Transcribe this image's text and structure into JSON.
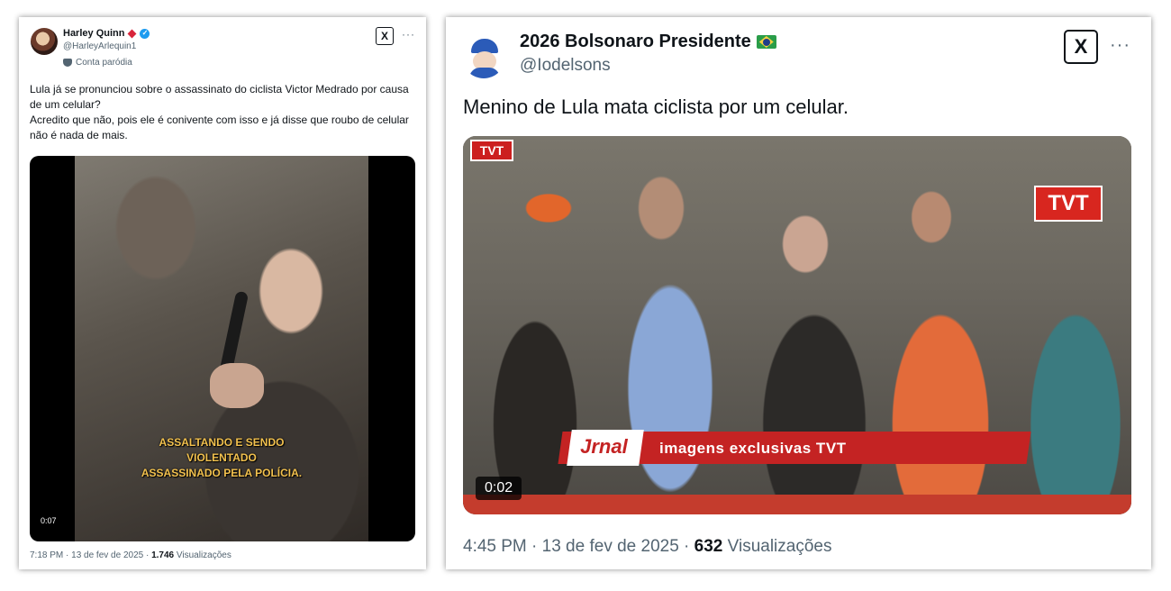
{
  "tweet1": {
    "name": "Harley Quinn",
    "handle": "@HarleyArlequin1",
    "parody": "Conta paródia",
    "text": [
      "Lula já se pronunciou sobre o assassinato do ciclista Victor Medrado por causa de um celular?",
      "Acredito que não,  pois ele é conivente com isso e já disse que roubo de celular não é nada de mais."
    ],
    "video": {
      "caption": [
        "ASSALTANDO E SENDO",
        "VIOLENTADO",
        "ASSASSINADO PELA POLÍCIA."
      ],
      "duration": "0:07"
    },
    "time": "7:18 PM · 13 de fev de 2025 · ",
    "views": "1.746",
    "views_label": " Visualizações"
  },
  "tweet2": {
    "name": "2026 Bolsonaro Presidente",
    "handle": "@Iodelsons",
    "text": "Menino de Lula mata ciclista por um celular.",
    "video": {
      "tvt_left": "TVT",
      "tvt_right": "TVT",
      "lower_logo": "Jrnal",
      "lower_text": "imagens exclusivas TVT",
      "duration": "0:02"
    },
    "time": "4:45 PM · 13 de fev de 2025 · ",
    "views": "632",
    "views_label": " Visualizações"
  },
  "icons": {
    "x_logo_glyph": "X",
    "more_glyph": "···",
    "verified_glyph": "✓"
  },
  "colors": {
    "verified": "#1d9bf0",
    "muted_text": "#536471",
    "caption_yellow": "#f2c14e",
    "tvt_red": "#cc1f1f"
  }
}
